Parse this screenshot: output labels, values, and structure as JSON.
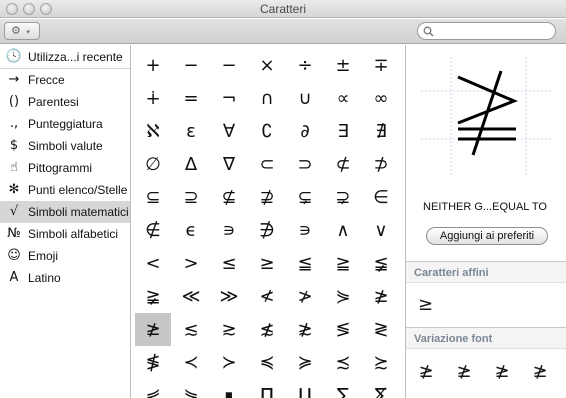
{
  "window": {
    "title": "Caratteri"
  },
  "toolbar": {
    "gear_icon": "⚙",
    "chevron": "▾",
    "search_placeholder": ""
  },
  "sidebar": {
    "items": [
      {
        "icon": "clock-icon",
        "glyph": "🕓",
        "label": "Utilizza...i recente",
        "selected": false
      },
      {
        "icon": "arrow-icon",
        "glyph": "→",
        "label": "Frecce",
        "selected": false
      },
      {
        "icon": "parentheses-icon",
        "glyph": "()",
        "label": "Parentesi",
        "selected": false
      },
      {
        "icon": "punctuation-icon",
        "glyph": ".,",
        "label": "Punteggiatura",
        "selected": false
      },
      {
        "icon": "dollar-icon",
        "glyph": "$",
        "label": "Simboli valute",
        "selected": false
      },
      {
        "icon": "pictogram-icon",
        "glyph": "☝",
        "label": "Pittogrammi",
        "selected": false
      },
      {
        "icon": "asterisk-icon",
        "glyph": "✻",
        "label": "Punti elenco/Stelle",
        "selected": false
      },
      {
        "icon": "sqrt-icon",
        "glyph": "√",
        "label": "Simboli matematici",
        "selected": true
      },
      {
        "icon": "numero-icon",
        "glyph": "№",
        "label": "Simboli alfabetici",
        "selected": false
      },
      {
        "icon": "smiley-icon",
        "glyph": "☺",
        "label": "Emoji",
        "selected": false
      },
      {
        "icon": "latin-a-icon",
        "glyph": "A",
        "label": "Latino",
        "selected": false
      }
    ]
  },
  "grid": {
    "rows": [
      [
        "+",
        "−",
        "−",
        "×",
        "÷",
        "±",
        "∓"
      ],
      [
        "∔",
        "=",
        "¬",
        "∩",
        "∪",
        "∝",
        "∞"
      ],
      [
        "ℵ",
        "ε",
        "∀",
        "∁",
        "∂",
        "∃",
        "∄"
      ],
      [
        "∅",
        "∆",
        "∇",
        "⊂",
        "⊃",
        "⊄",
        "⊅"
      ],
      [
        "⊆",
        "⊇",
        "⊈",
        "⊉",
        "⊊",
        "⊋",
        "∈"
      ],
      [
        "∉",
        "ϵ",
        "∍",
        "∌",
        "∍",
        "∧",
        "∨"
      ],
      [
        "<",
        ">",
        "≤",
        "≥",
        "≦",
        "≧",
        "≨"
      ],
      [
        "≩",
        "≪",
        "≫",
        "≮",
        "≯",
        "⋟",
        "≱"
      ],
      [
        "≱",
        "≲",
        "≳",
        "≴",
        "≵",
        "≶",
        "≷"
      ],
      [
        "≸",
        "≺",
        "≻",
        "≼",
        "≽",
        "≾",
        "≿"
      ],
      [
        "⋞",
        "⋟",
        "∎",
        "∏",
        "∐",
        "∑",
        "∑̸"
      ]
    ],
    "selected_row": 8,
    "selected_col": 0
  },
  "details": {
    "preview_glyph": "≱",
    "char_name": "NEITHER G...EQUAL TO",
    "fav_button": "Aggiungi ai preferiti",
    "related_heading": "Caratteri affini",
    "related_chars": [
      "≥"
    ],
    "font_variation_heading": "Variazione font",
    "font_variations": [
      "≱",
      "≱",
      "≱",
      "≱"
    ]
  }
}
